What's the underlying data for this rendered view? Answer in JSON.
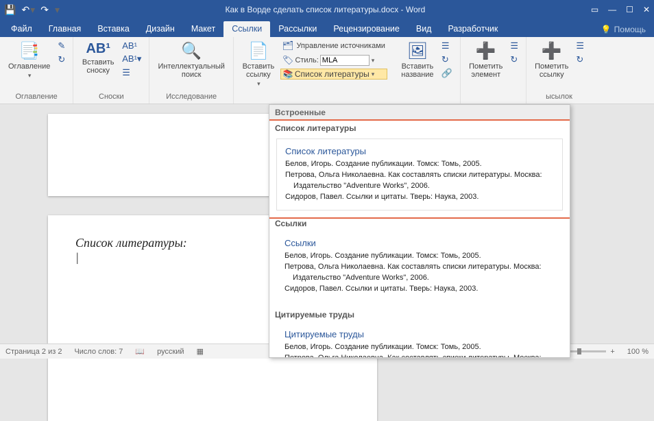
{
  "titlebar": {
    "title": "Как в Ворде сделать список литературы.docx - Word"
  },
  "tabs": {
    "file": "Файл",
    "home": "Главная",
    "insert": "Вставка",
    "design": "Дизайн",
    "layout": "Макет",
    "references": "Ссылки",
    "mailings": "Рассылки",
    "review": "Рецензирование",
    "view": "Вид",
    "developer": "Разработчик",
    "help": "Помощь"
  },
  "ribbon": {
    "toc_btn": "Оглавление",
    "toc_group": "Оглавление",
    "footnote_btn": "Вставить\nсноску",
    "footnote_group": "Сноски",
    "smartlookup_btn": "Интеллектуальный\nпоиск",
    "smartlookup_group": "Исследование",
    "insertcitation_btn": "Вставить\nссылку",
    "manage_sources": "Управление источниками",
    "style_label": "Стиль:",
    "style_value": "MLA",
    "bibliography_btn": "Список литературы",
    "insertcaption_btn": "Вставить\nназвание",
    "markentry_btn": "Пометить\nэлемент",
    "markcitation_btn": "Пометить\nссылку",
    "group_footnotes_ext": "AB¹",
    "group_captions_trail": "ысылок"
  },
  "gallery": {
    "header": "Встроенные",
    "sec1": "Список литературы",
    "sec2": "Ссылки",
    "sec3": "Цитируемые труды",
    "item1_title": "Список литературы",
    "item2_title": "Ссылки",
    "item3_title": "Цитируемые труды",
    "entry1": "Белов, Игорь. Создание публикации. Томск: Томь, 2005.",
    "entry2a": "Петрова, Ольга Николаевна. Как составлять списки литературы. Москва:",
    "entry2b": "Издательство \"Adventure Works\", 2006.",
    "entry3": "Сидоров, Павел. Ссылки и цитаты. Тверь: Наука, 2003."
  },
  "doc": {
    "heading": "Список литературы:",
    "cursor": "|"
  },
  "status": {
    "page": "Страница 2 из 2",
    "words": "Число слов: 7",
    "lang": "русский",
    "zoom": "100 %"
  }
}
